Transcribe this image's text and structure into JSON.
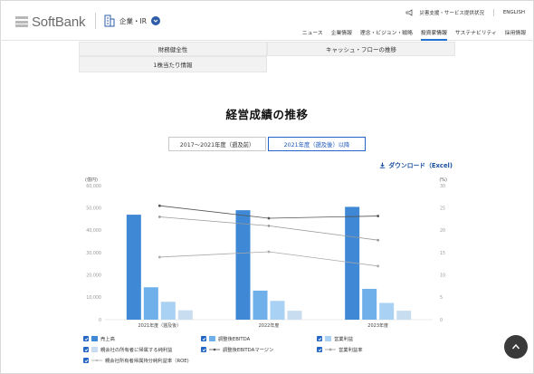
{
  "header": {
    "logo_text": "SoftBank",
    "site_label": "企業・IR",
    "util_links": [
      "災害支援・サービス提供状況",
      "ENGLISH"
    ],
    "nav": [
      "ニュース",
      "企業情報",
      "理念・ビジョン・戦略",
      "投資家情報",
      "サステナビリティ",
      "採用情報"
    ],
    "nav_active": "投資家情報"
  },
  "tabs": {
    "row1": [
      "財務健全性",
      "キャッシュ・フローの推移"
    ],
    "row2": [
      "1株当たり情報"
    ]
  },
  "section_title": "経営成績の推移",
  "period_tabs": [
    "2017〜2021年度（遡及前）",
    "2021年度（遡及後）以降"
  ],
  "period_active": "2021年度（遡及後）以降",
  "download_label": "ダウンロード（Excel)",
  "chart_data": {
    "type": "bar",
    "y_unit_left": "(億円)",
    "y_unit_right": "(%)",
    "left_ticks": [
      "0",
      "10,000",
      "20,000",
      "30,000",
      "40,000",
      "50,000",
      "60,000"
    ],
    "right_ticks": [
      "0",
      "5",
      "10",
      "15",
      "20",
      "25",
      "30"
    ],
    "ylim_left": [
      0,
      60000
    ],
    "ylim_right": [
      0,
      30
    ],
    "categories": [
      "2021年度（遡及後）",
      "2022年度",
      "2023年度"
    ],
    "series": [
      {
        "name": "売上高",
        "kind": "bar",
        "color": "#3f88d6",
        "values": [
          47000,
          49000,
          50500
        ]
      },
      {
        "name": "調整後EBITDA",
        "kind": "bar",
        "color": "#6fb0ea",
        "values": [
          14500,
          13000,
          13800
        ]
      },
      {
        "name": "営業利益",
        "kind": "bar",
        "color": "#a8d1f4",
        "values": [
          8000,
          8400,
          7500
        ]
      },
      {
        "name": "親会社の所有者に帰属する純利益",
        "kind": "bar",
        "color": "#c8def0",
        "values": [
          4200,
          4000,
          4000
        ]
      },
      {
        "name": "調整後EBITDAマージン",
        "kind": "line",
        "color": "#555555",
        "values": [
          25.5,
          22.7,
          23.2
        ]
      },
      {
        "name": "営業利益率",
        "kind": "line",
        "color": "#999999",
        "values": [
          23.0,
          21.0,
          17.8
        ]
      },
      {
        "name": "親会社所有者帰属持分純利益率（ROE)",
        "kind": "line",
        "color": "#aaaaaa",
        "values": [
          14.0,
          15.2,
          12.0
        ]
      }
    ],
    "grid": false,
    "legend_position": "bottom"
  },
  "legend": [
    [
      "売上高",
      "調整後EBITDA",
      "営業利益"
    ],
    [
      "親会社の所有者に帰属する純利益",
      "調整後EBITDAマージン",
      "営業利益率"
    ],
    [
      "親会社所有者帰属持分純利益率（ROE)"
    ]
  ]
}
